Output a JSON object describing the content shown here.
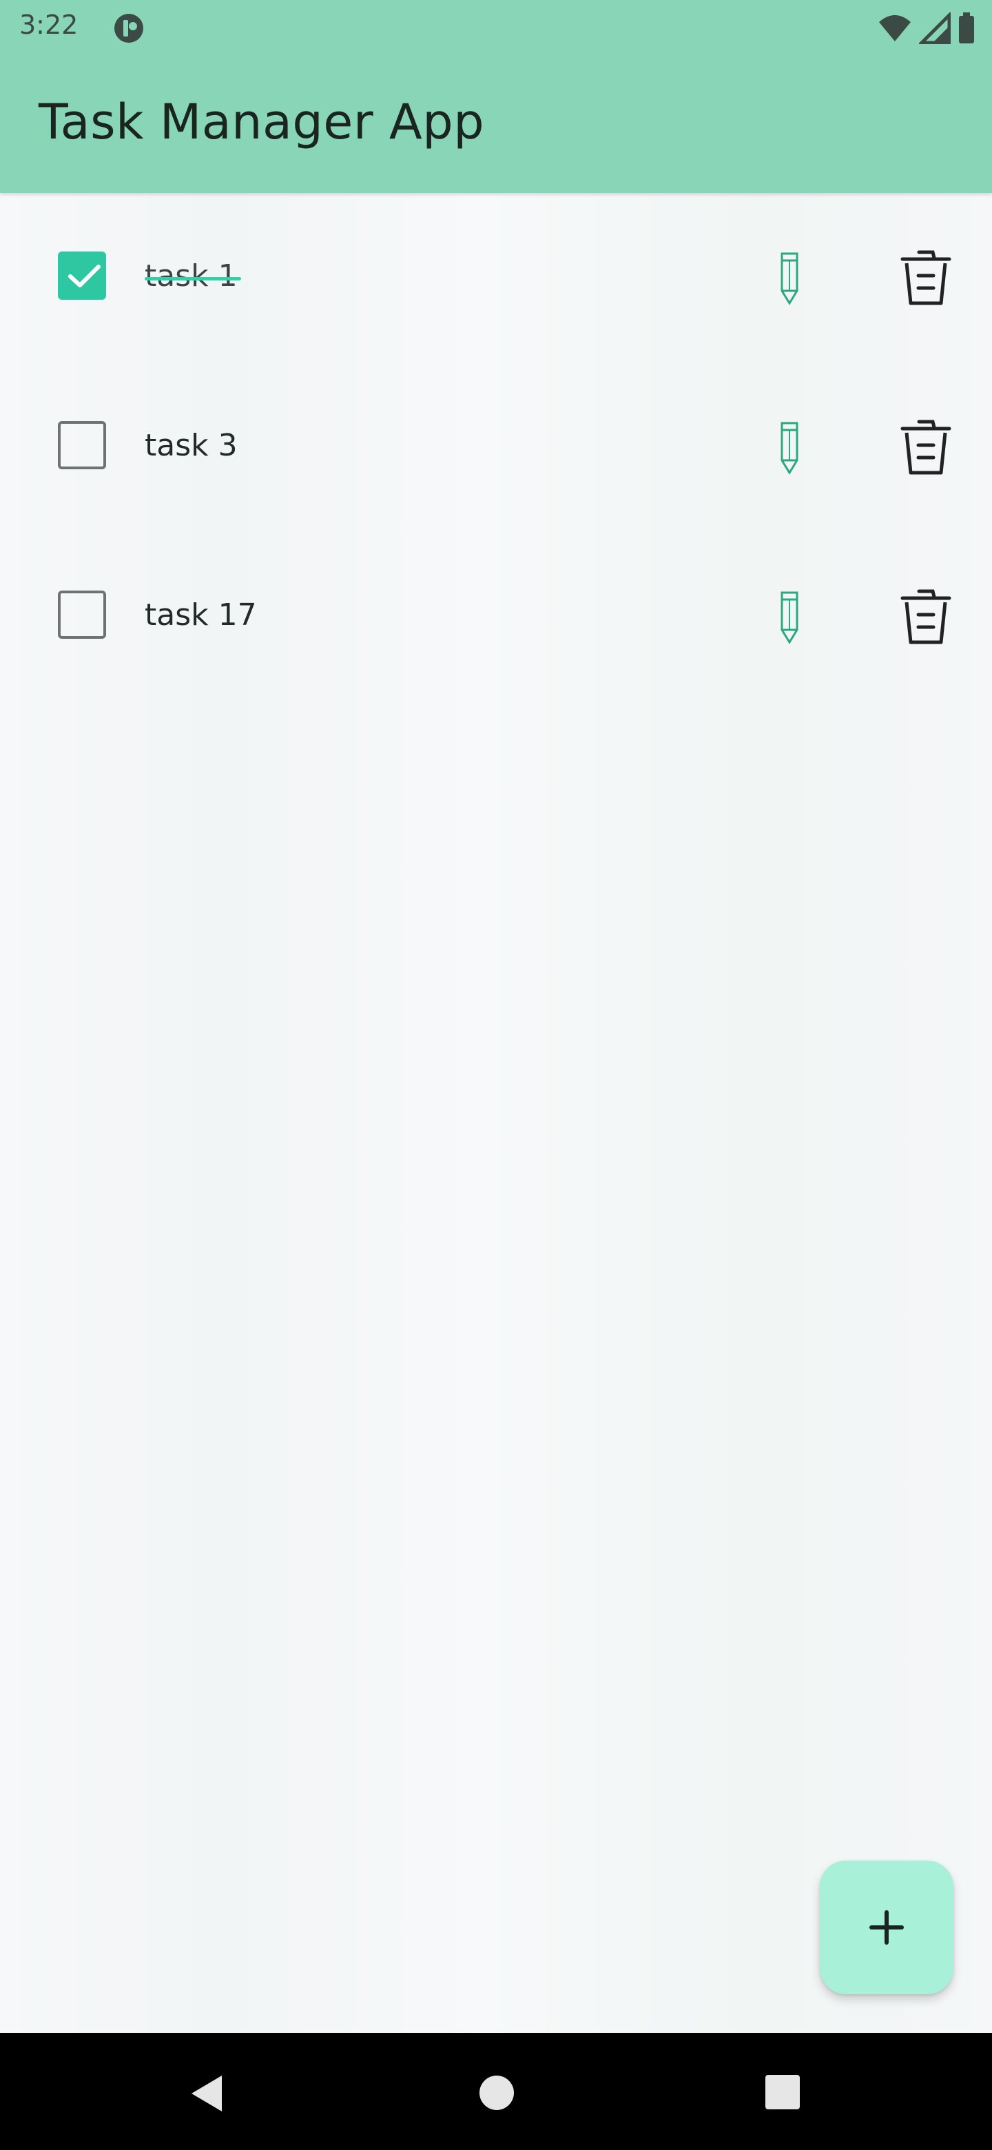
{
  "status_bar": {
    "time": "3:22",
    "icons": [
      "notification-icon",
      "wifi-icon",
      "signal-icon",
      "battery-icon"
    ]
  },
  "app_bar": {
    "title": "Task Manager App"
  },
  "tasks": [
    {
      "label": "task 1",
      "completed": true
    },
    {
      "label": "task 3",
      "completed": false
    },
    {
      "label": "task 17",
      "completed": false
    }
  ],
  "actions": {
    "edit_icon": "pencil-icon",
    "delete_icon": "trash-icon"
  },
  "fab": {
    "icon": "plus-icon"
  },
  "nav_bar": {
    "icons": [
      "back-icon",
      "home-icon",
      "recents-icon"
    ]
  },
  "colors": {
    "app_bar": "#88d5b8",
    "accent": "#2dc8a2",
    "fab": "#a8f0d8",
    "edit_icon": "#2aa87f",
    "background": "#f3f5f6"
  }
}
